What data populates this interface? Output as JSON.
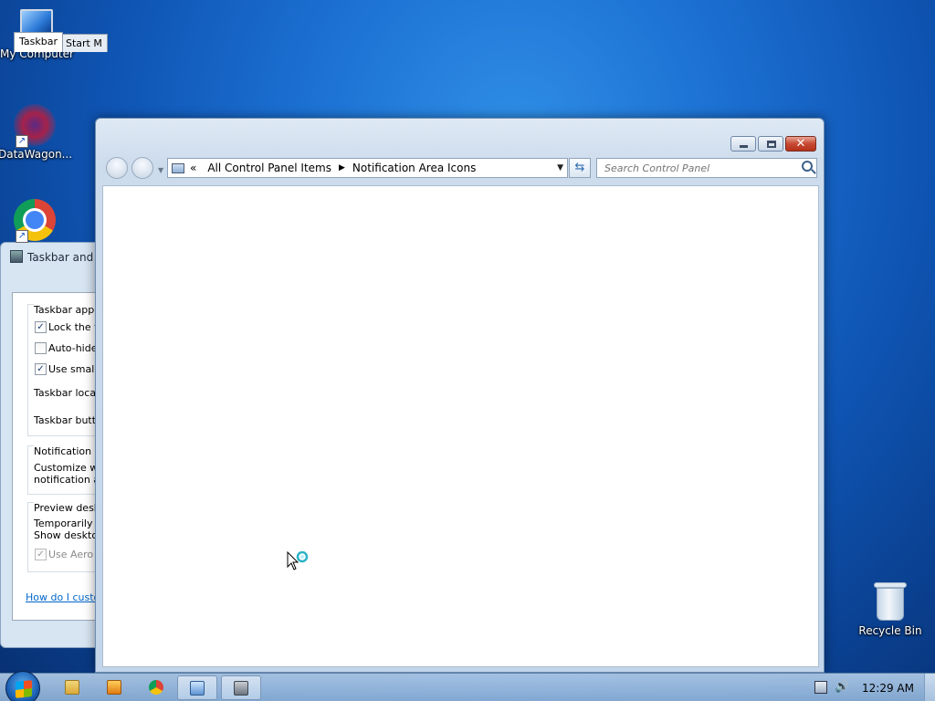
{
  "desktop": {
    "icons": [
      {
        "label": "My Computer",
        "icon": "computer-icon"
      },
      {
        "label": "DataWagon...",
        "icon": "datawagon-icon"
      },
      {
        "label": "",
        "icon": "chrome-icon"
      },
      {
        "label": "Recycle Bin",
        "icon": "recycle-bin-icon"
      }
    ]
  },
  "taskbar_dialog": {
    "title": "Taskbar and S",
    "tabs": [
      "Taskbar",
      "Start M"
    ],
    "group_appearance": "Taskbar appea",
    "checkboxes": [
      {
        "label": "Lock the ta",
        "checked": true
      },
      {
        "label": "Auto-hide",
        "checked": false
      },
      {
        "label": "Use small i",
        "checked": true
      }
    ],
    "location_label": "Taskbar locati",
    "buttons_label": "Taskbar butto",
    "notification_title": "Notification ar",
    "notification_text_1": "Customize wh",
    "notification_text_2": "notification ar",
    "preview_title": "Preview deskt",
    "preview_text_1": "Temporarily vi",
    "preview_text_2": "Show desktop",
    "aero_label": "Use Aero P",
    "help_link": "How do I custon"
  },
  "window": {
    "breadcrumb_prefix": "«",
    "breadcrumb": [
      "All Control Panel Items",
      "Notification Area Icons"
    ],
    "search_placeholder": "Search Control Panel",
    "close_glyph": "✕"
  },
  "taskbar": {
    "clock": "12:29 AM",
    "pinned": [
      "explorer-icon",
      "media-player-icon",
      "chrome-icon",
      "control-panel-icon",
      "taskbar-properties-icon"
    ]
  },
  "colors": {
    "desktop_bg": "#1b6fd1",
    "window_frame": "#c3d5ea",
    "close_button": "#c84a32"
  }
}
